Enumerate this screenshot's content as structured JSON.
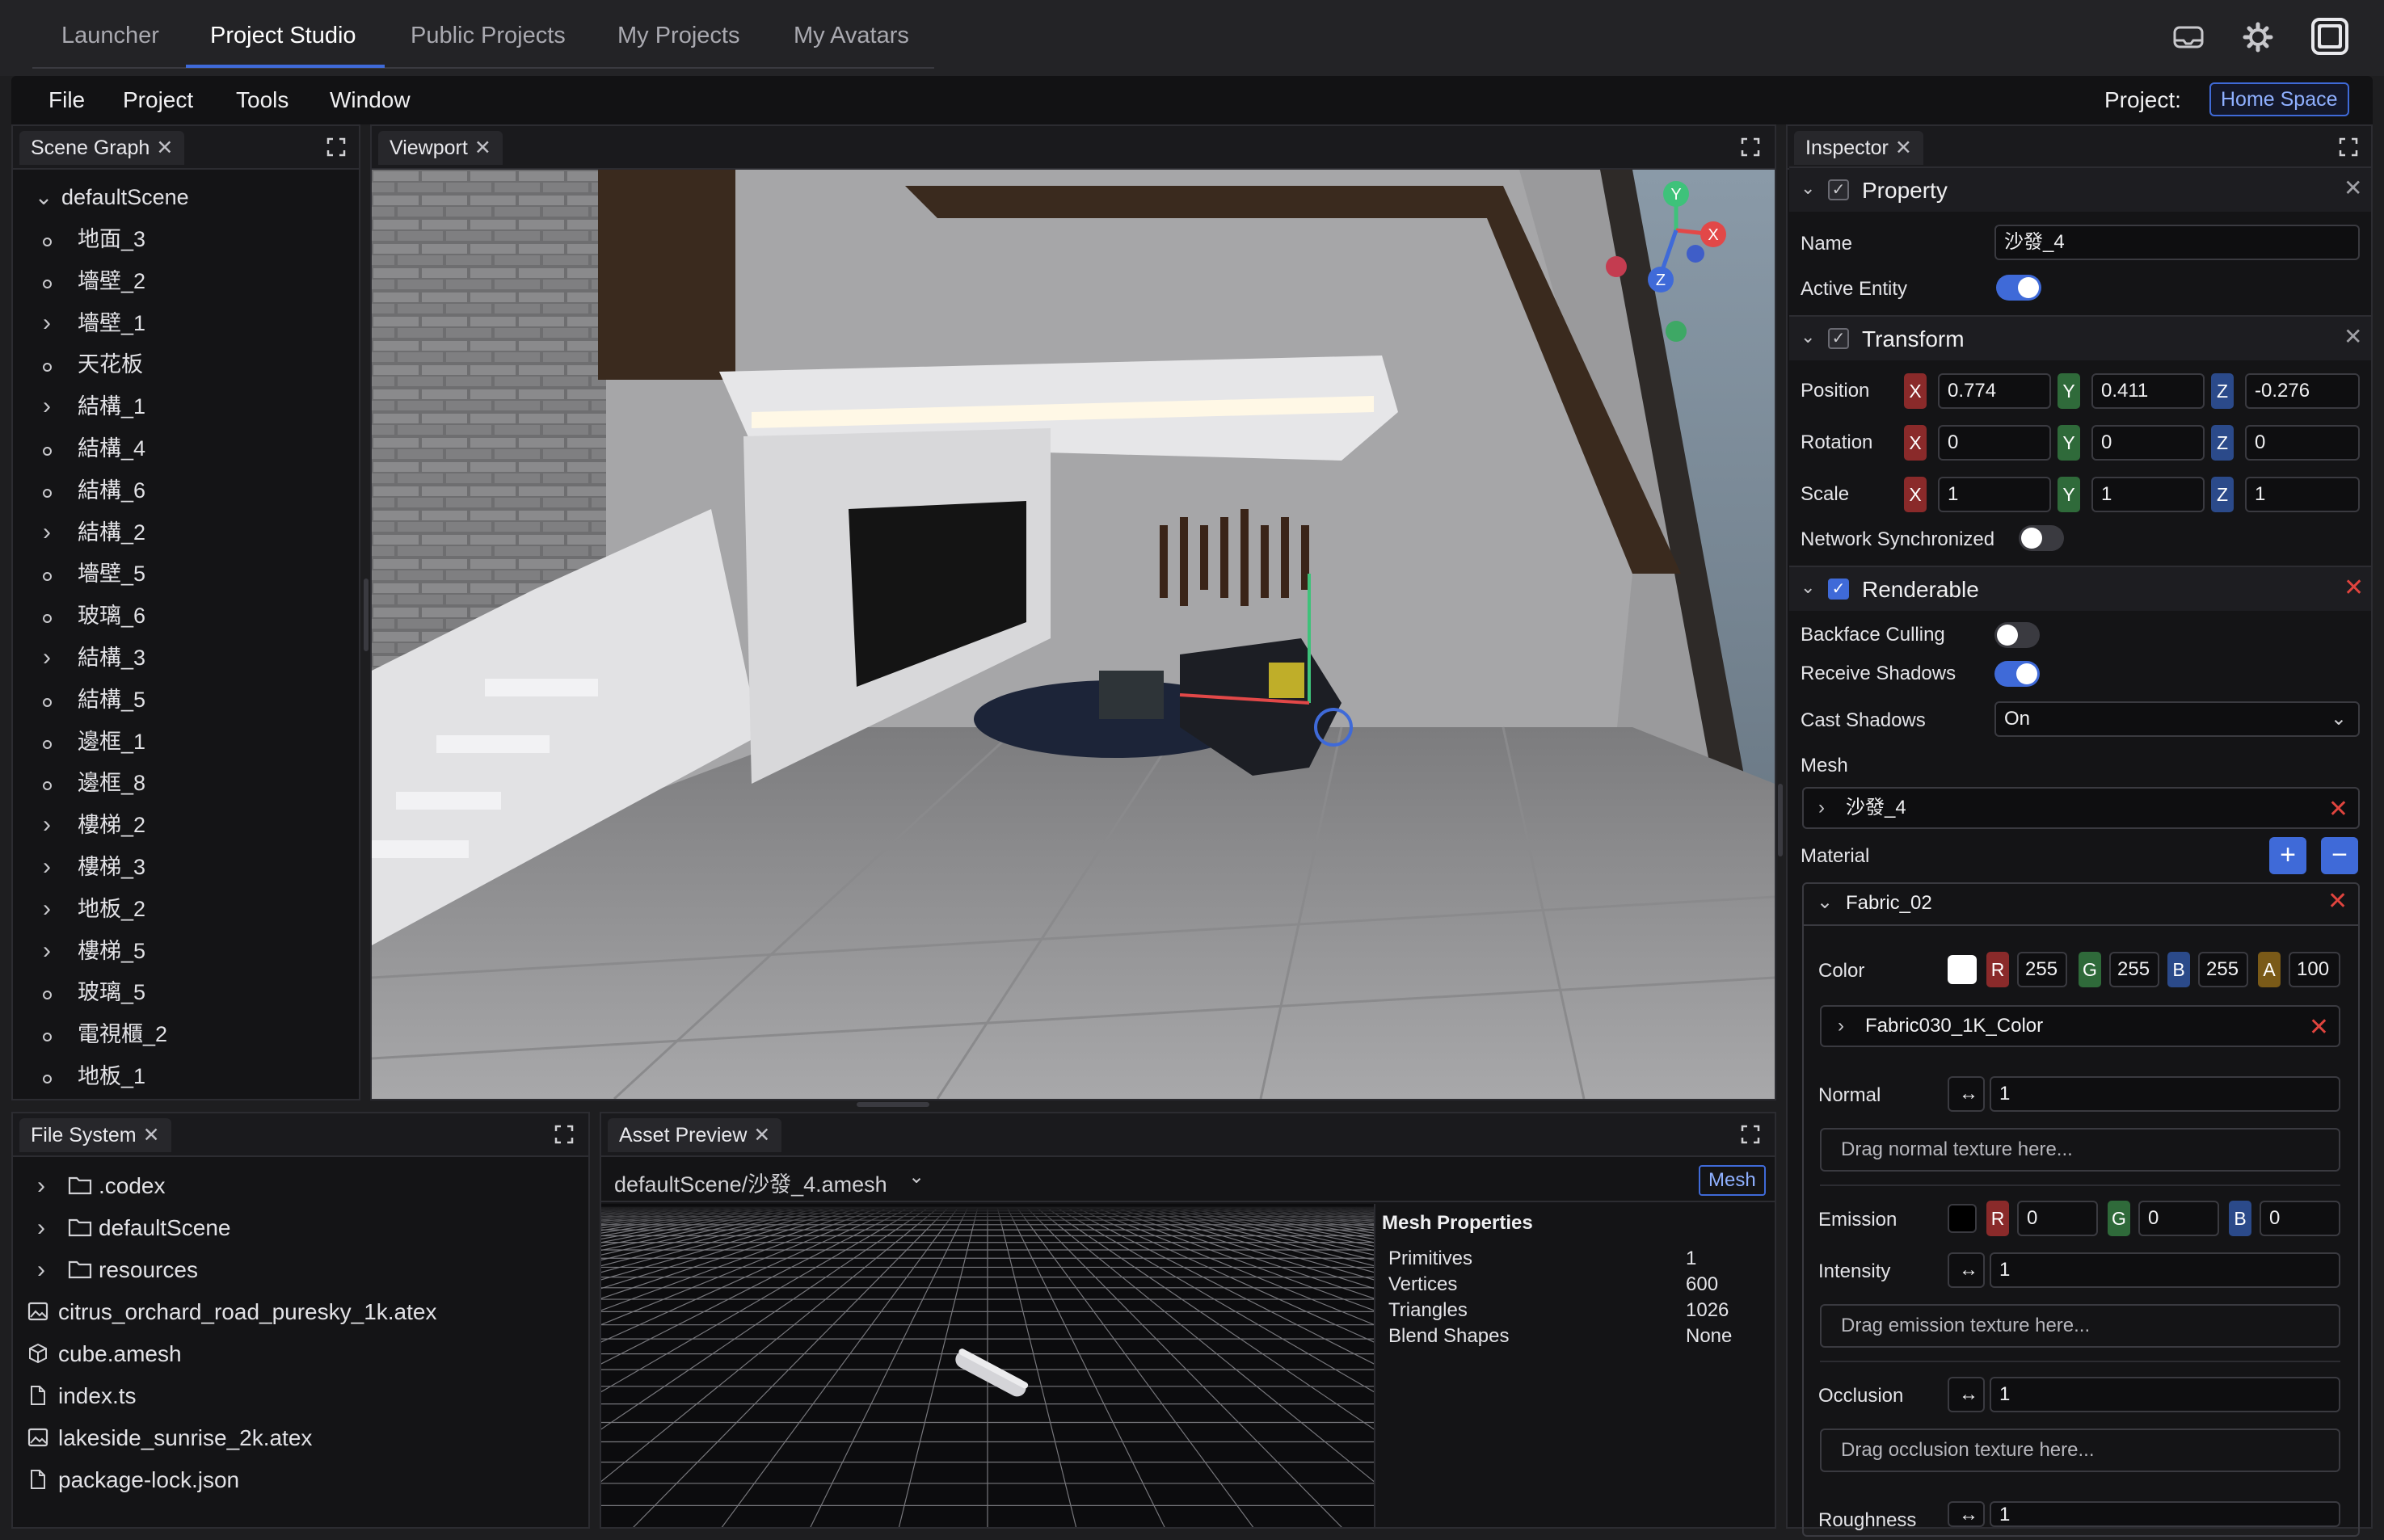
{
  "nav": {
    "tabs": [
      "Launcher",
      "Project Studio",
      "Public Projects",
      "My Projects",
      "My Avatars"
    ],
    "active_tab": "Project Studio",
    "icons": [
      "headset-icon",
      "gear-icon",
      "window-icon"
    ]
  },
  "menu": {
    "items": [
      "File",
      "Project",
      "Tools",
      "Window"
    ],
    "project_label": "Project:",
    "project_name": "Home Space"
  },
  "scene_graph": {
    "tab": "Scene Graph",
    "root": "defaultScene",
    "items": [
      {
        "label": "地面_3",
        "expandable": false
      },
      {
        "label": "墻壁_2",
        "expandable": false
      },
      {
        "label": "墻壁_1",
        "expandable": true
      },
      {
        "label": "天花板",
        "expandable": false
      },
      {
        "label": "結構_1",
        "expandable": true
      },
      {
        "label": "結構_4",
        "expandable": false
      },
      {
        "label": "結構_6",
        "expandable": false
      },
      {
        "label": "結構_2",
        "expandable": true
      },
      {
        "label": "墻壁_5",
        "expandable": false
      },
      {
        "label": "玻璃_6",
        "expandable": false
      },
      {
        "label": "結構_3",
        "expandable": true
      },
      {
        "label": "結構_5",
        "expandable": false
      },
      {
        "label": "邊框_1",
        "expandable": false
      },
      {
        "label": "邊框_8",
        "expandable": false
      },
      {
        "label": "樓梯_2",
        "expandable": true
      },
      {
        "label": "樓梯_3",
        "expandable": true
      },
      {
        "label": "地板_2",
        "expandable": true
      },
      {
        "label": "樓梯_5",
        "expandable": true
      },
      {
        "label": "玻璃_5",
        "expandable": false
      },
      {
        "label": "電視櫃_2",
        "expandable": false
      },
      {
        "label": "地板_1",
        "expandable": false
      }
    ]
  },
  "viewport": {
    "tab": "Viewport",
    "gizmo": {
      "y": "Y",
      "x": "X",
      "z": "Z"
    }
  },
  "inspector": {
    "tab": "Inspector",
    "property": {
      "title": "Property",
      "name_label": "Name",
      "name_value": "沙發_4",
      "active_label": "Active Entity",
      "active": true
    },
    "transform": {
      "title": "Transform",
      "position_label": "Position",
      "rotation_label": "Rotation",
      "scale_label": "Scale",
      "axis_x": "X",
      "axis_y": "Y",
      "axis_z": "Z",
      "position": [
        "0.774",
        "0.411",
        "-0.276"
      ],
      "rotation": [
        "0",
        "0",
        "0"
      ],
      "scale": [
        "1",
        "1",
        "1"
      ],
      "network_label": "Network Synchronized",
      "network": false
    },
    "renderable": {
      "title": "Renderable",
      "backface_label": "Backface Culling",
      "backface": false,
      "receive_label": "Receive Shadows",
      "receive": true,
      "cast_label": "Cast Shadows",
      "cast_value": "On",
      "mesh_label": "Mesh",
      "mesh_value": "沙發_4",
      "material_label": "Material",
      "material_name": "Fabric_02",
      "color_label": "Color",
      "rgba_labels": [
        "R",
        "G",
        "B",
        "A"
      ],
      "color": [
        "255",
        "255",
        "255",
        "100"
      ],
      "color_texture": "Fabric030_1K_Color",
      "normal_label": "Normal",
      "normal_value": "1",
      "normal_drop": "Drag normal texture here...",
      "emission_label": "Emission",
      "emission": [
        "0",
        "0",
        "0"
      ],
      "intensity_label": "Intensity",
      "intensity_value": "1",
      "emission_drop": "Drag emission texture here...",
      "occlusion_label": "Occlusion",
      "occlusion_value": "1",
      "occlusion_drop": "Drag occlusion texture here...",
      "roughness_label": "Roughness",
      "roughness_value": "1"
    }
  },
  "file_system": {
    "tab": "File System",
    "items": [
      {
        "label": ".codex",
        "type": "folder"
      },
      {
        "label": "defaultScene",
        "type": "folder"
      },
      {
        "label": "resources",
        "type": "folder"
      },
      {
        "label": "citrus_orchard_road_puresky_1k.atex",
        "type": "image"
      },
      {
        "label": "cube.amesh",
        "type": "mesh"
      },
      {
        "label": "index.ts",
        "type": "file"
      },
      {
        "label": "lakeside_sunrise_2k.atex",
        "type": "image"
      },
      {
        "label": "package-lock.json",
        "type": "file"
      }
    ]
  },
  "asset_preview": {
    "tab": "Asset Preview",
    "path": "defaultScene/沙發_4.amesh",
    "badge": "Mesh",
    "props_title": "Mesh Properties",
    "props": [
      {
        "label": "Primitives",
        "value": "1"
      },
      {
        "label": "Vertices",
        "value": "600"
      },
      {
        "label": "Triangles",
        "value": "1026"
      },
      {
        "label": "Blend Shapes",
        "value": "None"
      }
    ]
  },
  "colors": {
    "accent": "#3f6ad8",
    "danger": "#e0443e",
    "panel_bg": "#141416"
  }
}
